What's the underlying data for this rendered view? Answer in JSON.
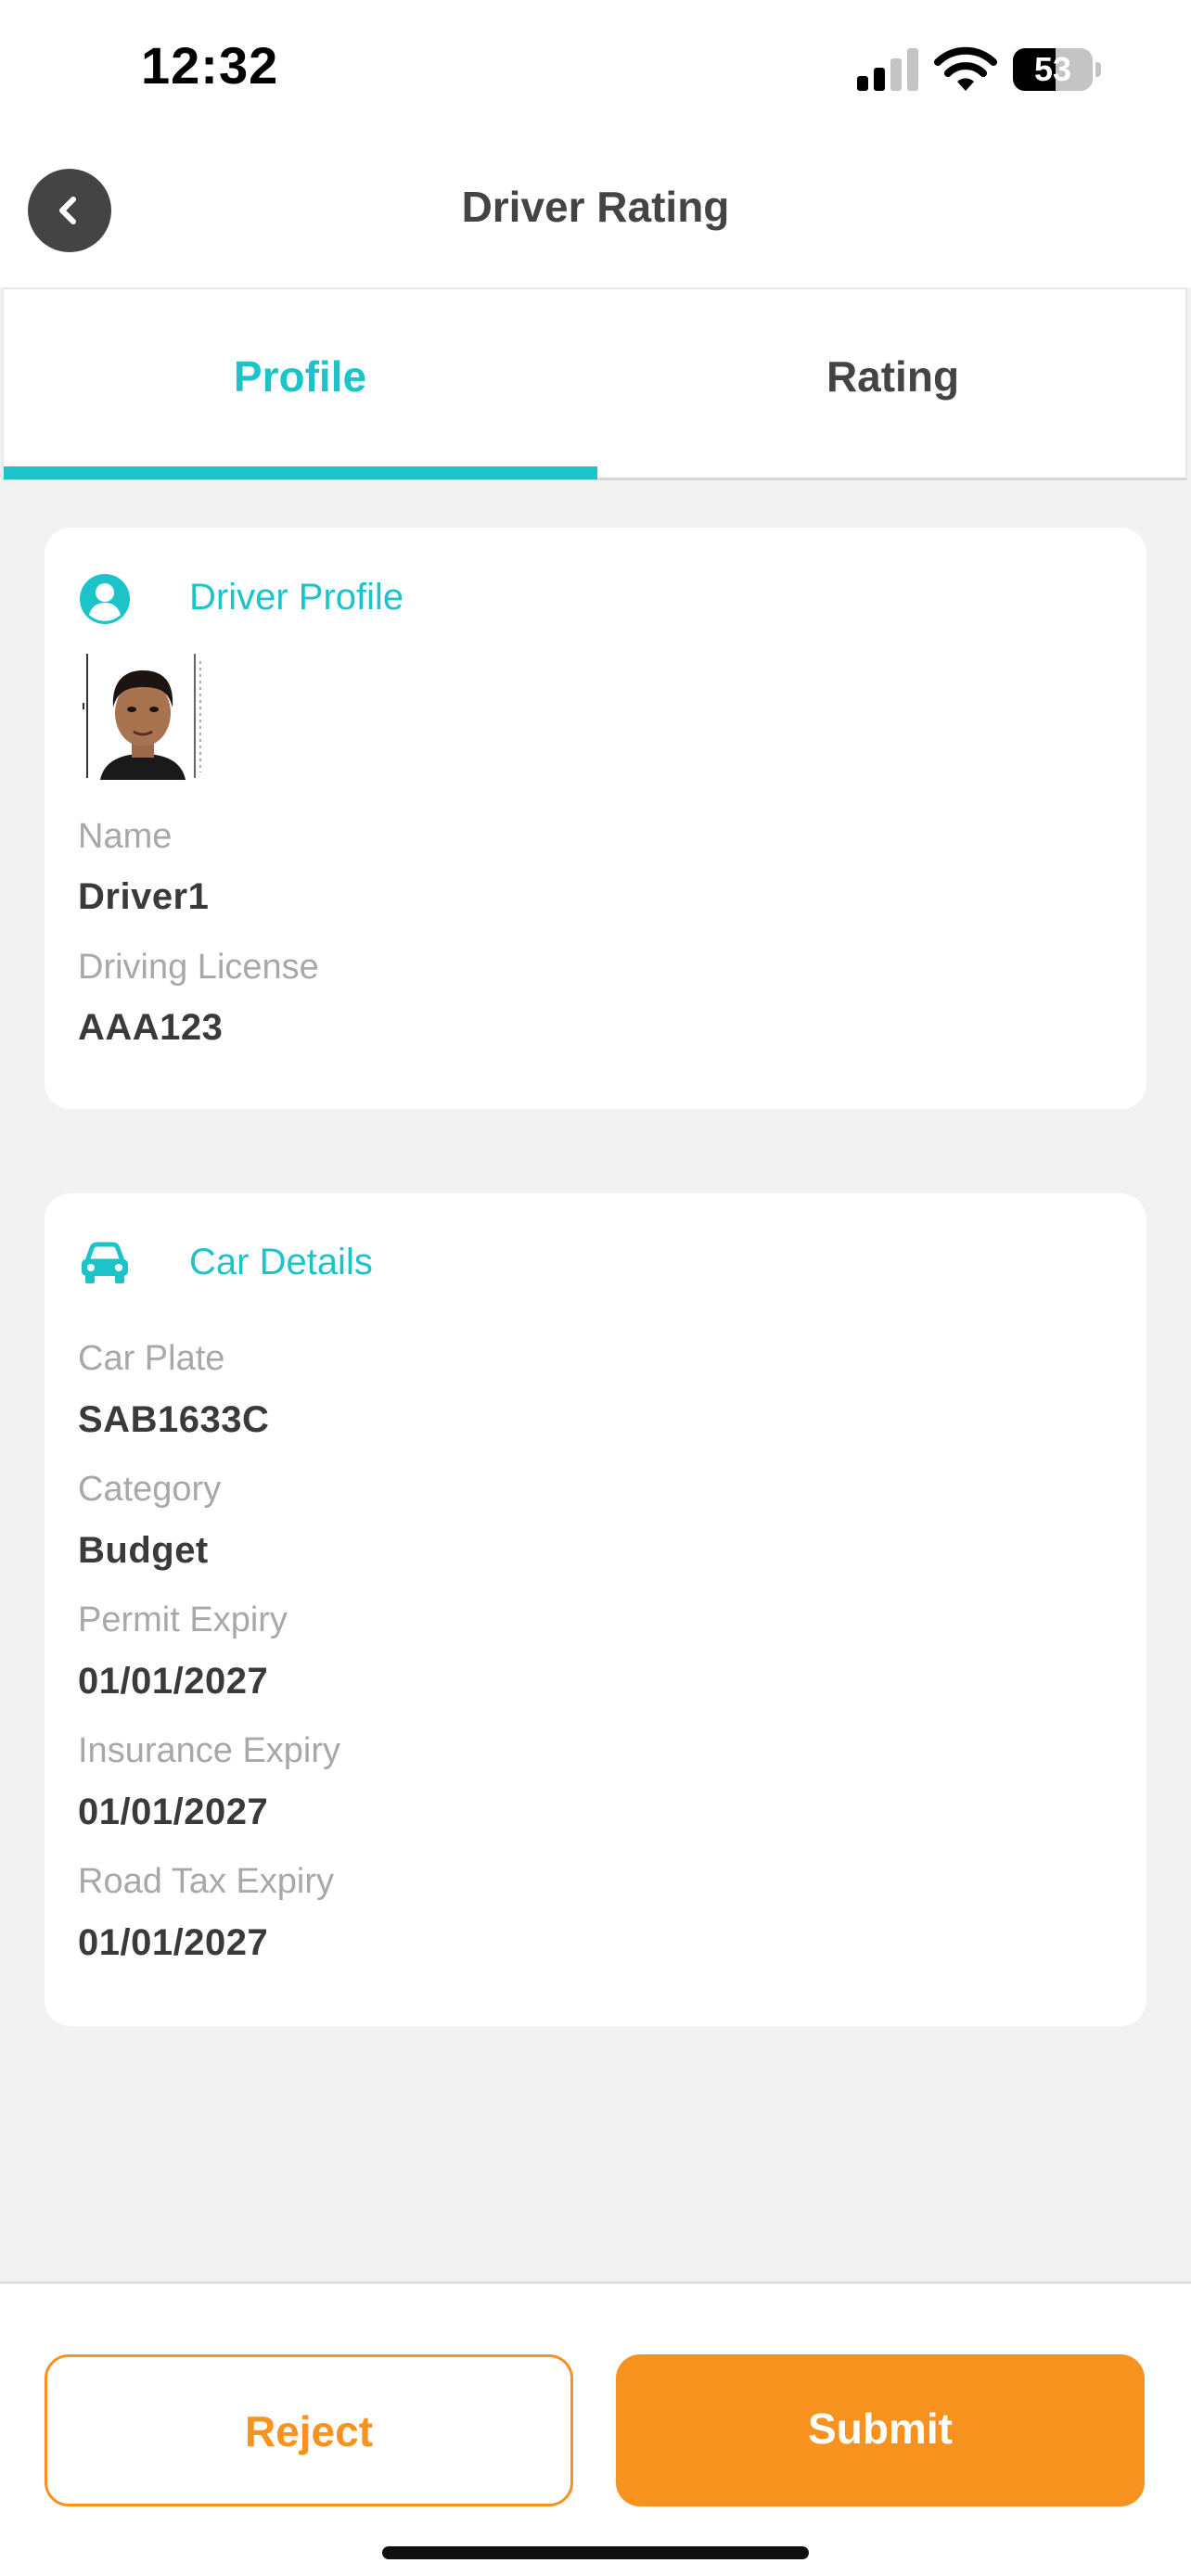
{
  "status_bar": {
    "time": "12:32",
    "battery_level": "53",
    "battery_fraction": 0.53
  },
  "header": {
    "title": "Driver Rating",
    "back_icon": "chevron-left-icon"
  },
  "tabs": [
    {
      "label": "Profile",
      "active": true
    },
    {
      "label": "Rating",
      "active": false
    }
  ],
  "driver_profile": {
    "title": "Driver Profile",
    "icon": "user-circle-icon",
    "avatar": "driver-photo",
    "fields": [
      {
        "label": "Name",
        "value": "Driver1"
      },
      {
        "label": "Driving License",
        "value": "AAA123"
      }
    ]
  },
  "car_details": {
    "title": "Car Details",
    "icon": "car-icon",
    "fields": [
      {
        "label": "Car Plate",
        "value": "SAB1633C"
      },
      {
        "label": "Category",
        "value": "Budget"
      },
      {
        "label": "Permit Expiry",
        "value": "01/01/2027"
      },
      {
        "label": "Insurance Expiry",
        "value": "01/01/2027"
      },
      {
        "label": "Road Tax Expiry",
        "value": "01/01/2027"
      }
    ]
  },
  "actions": {
    "reject_label": "Reject",
    "submit_label": "Submit"
  },
  "colors": {
    "accent": "#1cc4c9",
    "action": "#f7921f",
    "background": "#f2f2f2"
  }
}
